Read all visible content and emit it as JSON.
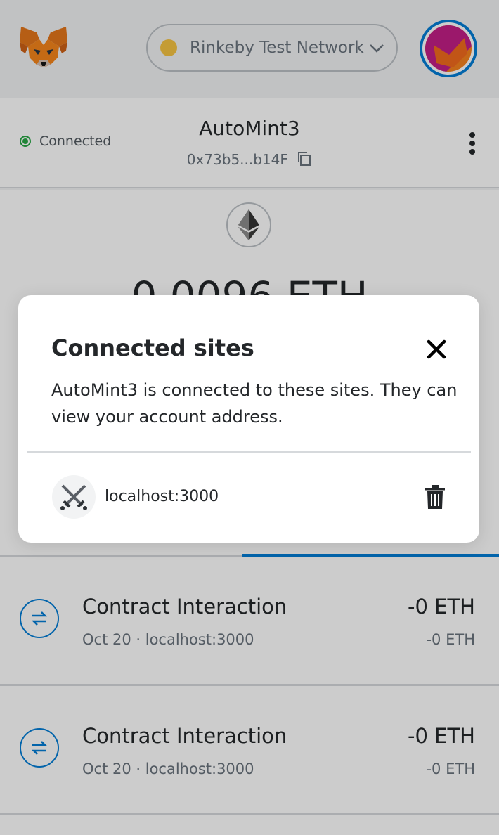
{
  "header": {
    "network_label": "Rinkeby Test Network",
    "network_color": "#f6c343",
    "logo_icon": "metamask-fox-icon",
    "account_avatar_icon": "jazzicon-avatar"
  },
  "account": {
    "status": "Connected",
    "name": "AutoMint3",
    "address": "0x73b5...b14F",
    "menu_icon": "kebab-menu-icon"
  },
  "wallet": {
    "balance": "0.0096 ETH",
    "asset_icon": "ethereum-icon"
  },
  "transactions": [
    {
      "title": "Contract Interaction",
      "subtitle": "Oct 20 · localhost:3000",
      "amount": "-0 ETH",
      "secondary_amount": "-0 ETH"
    },
    {
      "title": "Contract Interaction",
      "subtitle": "Oct 20 · localhost:3000",
      "amount": "-0 ETH",
      "secondary_amount": "-0 ETH"
    }
  ],
  "modal": {
    "title": "Connected sites",
    "description": "AutoMint3 is connected to these sites. They can view your account address.",
    "sites": [
      {
        "label": "localhost:3000",
        "icon": "crossed-swords-icon"
      }
    ]
  },
  "colors": {
    "accent": "#037dd6",
    "connected": "#28a745"
  }
}
